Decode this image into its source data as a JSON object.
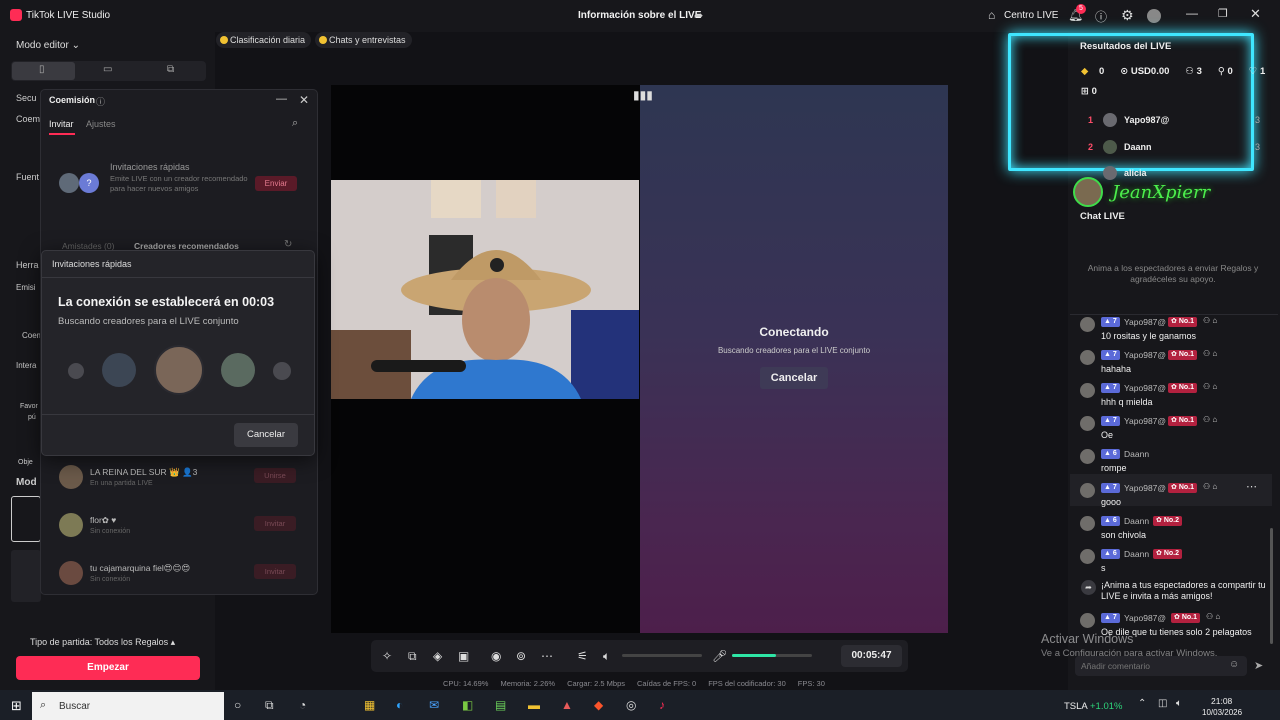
{
  "window": {
    "app_title": "TikTok LIVE Studio",
    "center_title": "Información sobre el LIVE",
    "centro_live": "Centro LIVE",
    "notification_count": "5"
  },
  "left": {
    "mode_editor": "Modo editor ⌄",
    "labels": [
      "Secu",
      "Coem",
      "Fuent",
      "Herra",
      "Emisi",
      "Coem",
      "Intera",
      "Favor",
      "pú",
      "Obje",
      "Mod"
    ],
    "tipo_partida": "Tipo de partida: Todos los Regalos ▴",
    "empezar": "Empezar"
  },
  "top_pills": [
    "Clasificación diaria",
    "Chats y entrevistas"
  ],
  "coem": {
    "title": "Coemisión",
    "tabs": [
      "Invitar",
      "Ajustes"
    ],
    "inv_title": "Invitaciones rápidas",
    "inv_desc": "Emite LIVE con un creador recomendado para hacer nuevos amigos",
    "enviar": "Enviar",
    "amistades": "Amistades (0)",
    "creadores": "Creadores recomendados",
    "contacts": [
      {
        "name": "LA REINA DEL SUR 👑  👤3",
        "sub": "En una partida LIVE",
        "btn": "Unirse"
      },
      {
        "name": "flor✿ ♥",
        "sub": "Sin conexión",
        "btn": "Invitar"
      },
      {
        "name": "tu cajamarquina fiel😍😊😍",
        "sub": "Sin conexión",
        "btn": "Invitar"
      }
    ]
  },
  "popup": {
    "header": "Invitaciones rápidas",
    "title": "La conexión se establecerá en 00:03",
    "subtitle": "Buscando creadores para el LIVE conjunto",
    "cancel": "Cancelar"
  },
  "stage": {
    "conectando": "Conectando",
    "conectando_sub": "Buscando creadores para el LIVE conjunto",
    "cancelar": "Cancelar"
  },
  "controls": {
    "timer": "00:05:47",
    "mic_level": 0.55
  },
  "stats": [
    "CPU: 14.69%",
    "Memoria: 2.26%",
    "Cargar: 2.5 Mbps",
    "Caídas de FPS: 0",
    "FPS del codificador: 30",
    "FPS: 30"
  ],
  "results": {
    "title": "Resultados del LIVE",
    "coins": "0",
    "usd": "USD0.00",
    "viewers": "3",
    "follows": "0",
    "likes": "1",
    "gifts": "0",
    "ranking": [
      {
        "pos": "1",
        "name": "Yapo987@",
        "n": "3",
        "color": "#ff4d6a"
      },
      {
        "pos": "2",
        "name": "Daann",
        "n": "3",
        "color": "#ff4d6a"
      },
      {
        "pos": "",
        "name": "alicia",
        "n": "",
        "color": "#aaa"
      }
    ]
  },
  "overlay_name": "JeanXpierr",
  "chat": {
    "title": "Chat LIVE",
    "empty": "Anima a los espectadores a enviar Regalos y agradéceles su apoyo.",
    "messages": [
      {
        "lvl": "7",
        "name": "Yapo987@",
        "rank": "No.1",
        "text": "10 rositas y le ganamos"
      },
      {
        "lvl": "7",
        "name": "Yapo987@",
        "rank": "No.1",
        "text": "hahaha"
      },
      {
        "lvl": "7",
        "name": "Yapo987@",
        "rank": "No.1",
        "text": "hhh q mielda"
      },
      {
        "lvl": "7",
        "name": "Yapo987@",
        "rank": "No.1",
        "text": "Oe"
      },
      {
        "lvl": "6",
        "name": "Daann",
        "rank": "",
        "text": "rompe"
      },
      {
        "lvl": "7",
        "name": "Yapo987@",
        "rank": "No.1",
        "text": "gooo"
      },
      {
        "lvl": "6",
        "name": "Daann",
        "rank": "No.2",
        "text": "son chivola"
      },
      {
        "lvl": "6",
        "name": "Daann",
        "rank": "No.2",
        "text": "s"
      }
    ],
    "share_prompt": "¡Anima a tus espectadores a compartir tu LIVE e invita a más amigos!",
    "last": {
      "lvl": "7",
      "name": "Yapo987@",
      "rank": "No.1",
      "text": "Oe dile que tu tienes solo 2 pelagatos"
    },
    "input_placeholder": "Añadir comentario"
  },
  "windows_activation": {
    "line1": "Activar Windows",
    "line2": "Ve a Configuración para activar Windows."
  },
  "taskbar": {
    "search": "Buscar",
    "ticker": "TSLA",
    "ticker_change": "+1.01%",
    "time": "21:08",
    "date": "10/03/2026"
  }
}
